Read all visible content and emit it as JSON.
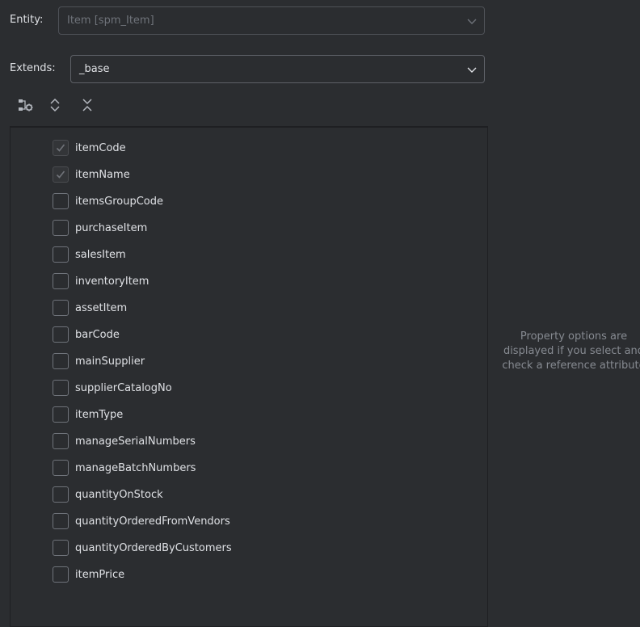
{
  "entity": {
    "label": "Entity:",
    "value": "Item [spm_Item]"
  },
  "extends": {
    "label": "Extends:",
    "value": "_base"
  },
  "toolbar": {
    "icons": [
      "hierarchy-settings-icon",
      "expand-all-icon",
      "collapse-all-icon"
    ]
  },
  "attributes": [
    {
      "name": "itemCode",
      "checked": true,
      "enabled": false
    },
    {
      "name": "itemName",
      "checked": true,
      "enabled": false
    },
    {
      "name": "itemsGroupCode",
      "checked": false,
      "enabled": true
    },
    {
      "name": "purchaseItem",
      "checked": false,
      "enabled": true
    },
    {
      "name": "salesItem",
      "checked": false,
      "enabled": true
    },
    {
      "name": "inventoryItem",
      "checked": false,
      "enabled": true
    },
    {
      "name": "assetItem",
      "checked": false,
      "enabled": true
    },
    {
      "name": "barCode",
      "checked": false,
      "enabled": true
    },
    {
      "name": "mainSupplier",
      "checked": false,
      "enabled": true
    },
    {
      "name": "supplierCatalogNo",
      "checked": false,
      "enabled": true
    },
    {
      "name": "itemType",
      "checked": false,
      "enabled": true
    },
    {
      "name": "manageSerialNumbers",
      "checked": false,
      "enabled": true
    },
    {
      "name": "manageBatchNumbers",
      "checked": false,
      "enabled": true
    },
    {
      "name": "quantityOnStock",
      "checked": false,
      "enabled": true
    },
    {
      "name": "quantityOrderedFromVendors",
      "checked": false,
      "enabled": true
    },
    {
      "name": "quantityOrderedByCustomers",
      "checked": false,
      "enabled": true
    },
    {
      "name": "itemPrice",
      "checked": false,
      "enabled": true
    }
  ],
  "hint": {
    "line1": "Property options are",
    "line2": "displayed if you select and",
    "line3": "check a reference attribute"
  },
  "colors": {
    "background": "#2b2d30",
    "text": "#dfe1e5",
    "muted_text": "#868a91",
    "disabled_text": "#6f737a",
    "border": "#4e5157"
  }
}
